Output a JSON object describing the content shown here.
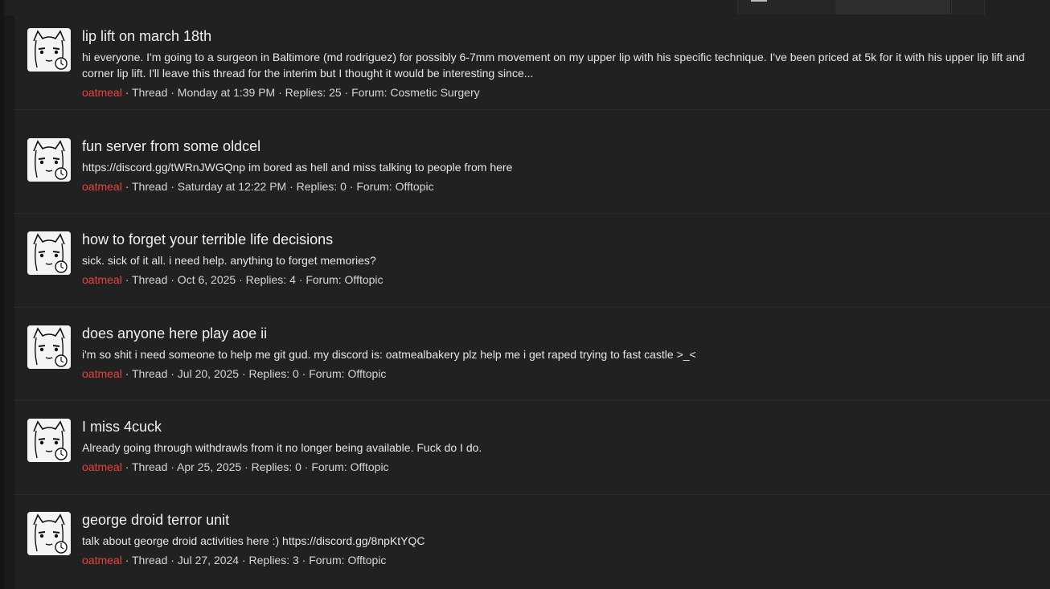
{
  "threads": [
    {
      "title": "lip lift on march 18th",
      "snippet": "hi everyone. I'm going to a surgeon in Baltimore (md rodriguez) for possibly 6-7mm movement on my upper lip with his specific technique. I've been priced at 5k for it with his upper lip lift and corner lip lift. I'll leave this thread for the interim but I thought it would be interesting since...",
      "author": "oatmeal",
      "meta": " · Thread · Monday at 1:39 PM · Replies: 25 · Forum: Cosmetic Surgery"
    },
    {
      "title": "fun server from some oldcel",
      "snippet": "https://discord.gg/tWRnJWGQnp im bored as hell and miss talking to people from here",
      "author": "oatmeal",
      "meta": " · Thread · Saturday at 12:22 PM · Replies: 0 · Forum: Offtopic"
    },
    {
      "title": "how to forget your terrible life decisions",
      "snippet": "sick. sick of it all. i need help. anything to forget memories?",
      "author": "oatmeal",
      "meta": " · Thread · Oct 6, 2025 · Replies: 4 · Forum: Offtopic"
    },
    {
      "title": "does anyone here play aoe ii",
      "snippet": "i'm so shit i need someone to help me git gud. my discord is: oatmealbakery plz help me i get raped trying to fast castle >_<",
      "author": "oatmeal",
      "meta": " · Thread · Jul 20, 2025 · Replies: 0 · Forum: Offtopic"
    },
    {
      "title": "I miss 4cuck",
      "snippet": "Already going through withdrawls from it no longer being available. Fuck do I do.",
      "author": "oatmeal",
      "meta": " · Thread · Apr 25, 2025 · Replies: 0 · Forum: Offtopic"
    },
    {
      "title": "george droid terror unit",
      "snippet": "talk about george droid activities here :) https://discord.gg/8npKtYQC",
      "author": "oatmeal",
      "meta": " · Thread · Jul 27, 2024 · Replies: 3 · Forum: Offtopic"
    }
  ],
  "colors": {
    "author": "#e8443a",
    "background": "#212121",
    "text": "#f0f0f0"
  }
}
